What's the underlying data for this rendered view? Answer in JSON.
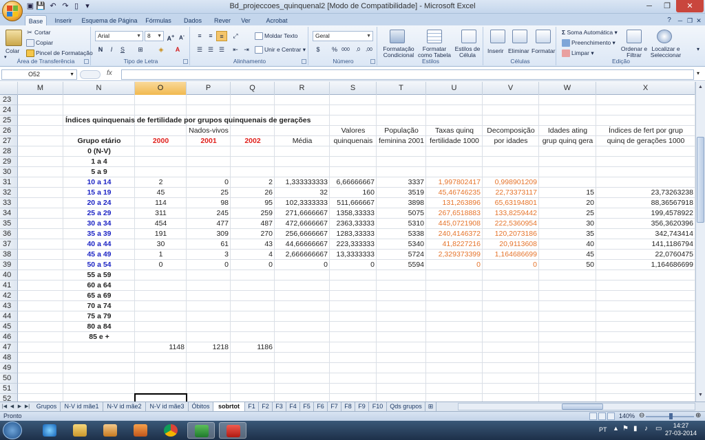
{
  "window": {
    "title": "Bd_projeccoes_quinquenal2  [Modo de Compatibilidade] - Microsoft Excel"
  },
  "ribbon": {
    "tabs": [
      "Base",
      "Inserir",
      "Esquema de Página",
      "Fórmulas",
      "Dados",
      "Rever",
      "Ver",
      "Acrobat"
    ],
    "clipboard": {
      "paste": "Colar",
      "cut": "Cortar",
      "copy": "Copiar",
      "format_painter": "Pincel de Formatação",
      "label": "Área de Transferência"
    },
    "font": {
      "family": "Arial",
      "size": "8",
      "label": "Tipo de Letra"
    },
    "alignment": {
      "wrap": "Moldar Texto",
      "merge": "Unir e Centrar",
      "label": "Alinhamento"
    },
    "number": {
      "format": "Geral",
      "label": "Número"
    },
    "styles": {
      "conditional": "Formatação Condicional",
      "table": "Formatar como Tabela",
      "cell": "Estilos de Célula",
      "label": "Estilos"
    },
    "cells": {
      "insert": "Inserir",
      "delete": "Eliminar",
      "format": "Formatar",
      "label": "Células"
    },
    "editing": {
      "autosum": "Soma Automática",
      "fill": "Preenchimento",
      "clear": "Limpar",
      "sort": "Ordenar e Filtrar",
      "find": "Localizar e Seleccionar",
      "label": "Edição"
    }
  },
  "formula_bar": {
    "name_box": "O52",
    "fx": "fx",
    "value": ""
  },
  "columns": [
    "M",
    "N",
    "O",
    "P",
    "Q",
    "R",
    "S",
    "T",
    "U",
    "V",
    "W",
    "X"
  ],
  "rows": [
    "23",
    "24",
    "25",
    "26",
    "27",
    "28",
    "29",
    "30",
    "31",
    "32",
    "33",
    "34",
    "35",
    "36",
    "37",
    "38",
    "39",
    "40",
    "41",
    "42",
    "43",
    "44",
    "45",
    "46",
    "47",
    "48",
    "49",
    "50",
    "51",
    "52"
  ],
  "sheet": {
    "title": "Índices quinquenais de fertilidade por grupos quinquenais de gerações",
    "headers26": {
      "P": "Nados-vivos",
      "S": "Valores",
      "T": "População",
      "U": "Taxas quinq",
      "V": "Decomposição",
      "W": "Idades ating",
      "X": "Índices de fert por grup"
    },
    "headers27": {
      "N": "Grupo etário",
      "O": "2000",
      "P": "2001",
      "Q": "2002",
      "R": "Média",
      "S": "quinquenais",
      "T": "feminina 2001",
      "U": "fertilidade 1000",
      "V": "por idades",
      "W": "grup quinq gera",
      "X": "quinq de gerações 1000"
    },
    "age_groups": [
      "0 (N-V)",
      "1 a 4",
      "5 a 9",
      "10 a 14",
      "15 a 19",
      "20 a 24",
      "25 a 29",
      "30 a 34",
      "35 a 39",
      "40 a 44",
      "45 a 49",
      "50 a 54",
      "55 a 59",
      "60 a 64",
      "65 a 69",
      "70 a 74",
      "75 a 79",
      "80 a 84",
      "85 e +"
    ],
    "data": [
      {
        "O": "2",
        "P": "0",
        "Q": "2",
        "R": "1,333333333",
        "S": "6,66666667",
        "T": "3337",
        "U": "1,997802417",
        "V": "0,998901209",
        "W": "",
        "X": ""
      },
      {
        "O": "45",
        "P": "25",
        "Q": "26",
        "R": "32",
        "S": "160",
        "T": "3519",
        "U": "45,46746235",
        "V": "22,73373117",
        "W": "15",
        "X": "23,73263238"
      },
      {
        "O": "114",
        "P": "98",
        "Q": "95",
        "R": "102,3333333",
        "S": "511,666667",
        "T": "3898",
        "U": "131,263896",
        "V": "65,63194801",
        "W": "20",
        "X": "88,36567918"
      },
      {
        "O": "311",
        "P": "245",
        "Q": "259",
        "R": "271,6666667",
        "S": "1358,33333",
        "T": "5075",
        "U": "267,6518883",
        "V": "133,8259442",
        "W": "25",
        "X": "199,4578922"
      },
      {
        "O": "454",
        "P": "477",
        "Q": "487",
        "R": "472,6666667",
        "S": "2363,33333",
        "T": "5310",
        "U": "445,0721908",
        "V": "222,5360954",
        "W": "30",
        "X": "356,3620396"
      },
      {
        "O": "191",
        "P": "309",
        "Q": "270",
        "R": "256,6666667",
        "S": "1283,33333",
        "T": "5338",
        "U": "240,4146372",
        "V": "120,2073186",
        "W": "35",
        "X": "342,743414"
      },
      {
        "O": "30",
        "P": "61",
        "Q": "43",
        "R": "44,66666667",
        "S": "223,333333",
        "T": "5340",
        "U": "41,8227216",
        "V": "20,9113608",
        "W": "40",
        "X": "141,1186794"
      },
      {
        "O": "1",
        "P": "3",
        "Q": "4",
        "R": "2,666666667",
        "S": "13,3333333",
        "T": "5724",
        "U": "2,329373399",
        "V": "1,164686699",
        "W": "45",
        "X": "22,0760475"
      },
      {
        "O": "0",
        "P": "0",
        "Q": "0",
        "R": "0",
        "S": "0",
        "T": "5594",
        "U": "0",
        "V": "0",
        "W": "50",
        "X": "1,164686699"
      }
    ],
    "totals": {
      "O": "1148",
      "P": "1218",
      "Q": "1186"
    }
  },
  "sheet_tabs": [
    "Grupos",
    "N-V id mãe1",
    "N-V id mãe2",
    "N-V id mãe3",
    "Óbitos",
    "sobrtot",
    "F1",
    "F2",
    "F3",
    "F4",
    "F5",
    "F6",
    "F7",
    "F8",
    "F9",
    "F10",
    "Qds grupos"
  ],
  "active_sheet": "sobrtot",
  "status": {
    "text": "Pronto",
    "zoom": "140%"
  },
  "taskbar": {
    "lang": "PT",
    "time": "14:27",
    "date": "27-03-2014"
  },
  "colors": {
    "ribbon": "#dce7f5",
    "selected_col": "#f1b94f",
    "red": "#e0211d",
    "blue": "#1d25c4",
    "orange": "#e5732a"
  }
}
